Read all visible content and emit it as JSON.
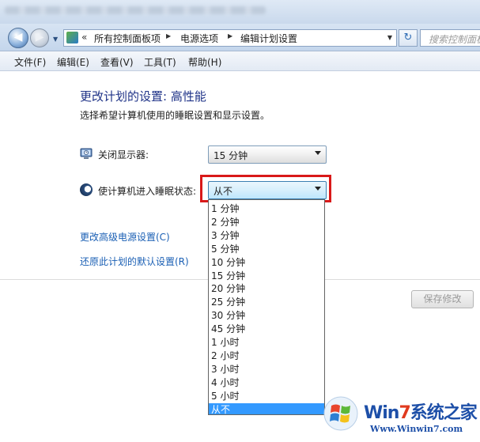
{
  "nav": {
    "back_glyph": "◀",
    "forward_glyph": "▶",
    "breadcrumb_prefix": "«",
    "breadcrumbs": [
      "所有控制面板项",
      "电源选项",
      "编辑计划设置"
    ],
    "refresh_glyph": "↻",
    "search_placeholder": "搜索控制面板"
  },
  "menu": [
    "文件(F)",
    "编辑(E)",
    "查看(V)",
    "工具(T)",
    "帮助(H)"
  ],
  "page": {
    "title": "更改计划的设置: 高性能",
    "subtitle": "选择希望计算机使用的睡眠设置和显示设置。"
  },
  "settings": {
    "display_label": "关闭显示器:",
    "display_value": "15 分钟",
    "sleep_label": "使计算机进入睡眠状态:",
    "sleep_value": "从不"
  },
  "dropdown_options": [
    "1 分钟",
    "2 分钟",
    "3 分钟",
    "5 分钟",
    "10 分钟",
    "15 分钟",
    "20 分钟",
    "25 分钟",
    "30 分钟",
    "45 分钟",
    "1 小时",
    "2 小时",
    "3 小时",
    "4 小时",
    "5 小时",
    "从不"
  ],
  "dropdown_selected": "从不",
  "links": {
    "advanced": "更改高级电源设置(C)",
    "restore": "还原此计划的默认设置(R)"
  },
  "buttons": {
    "save": "保存修改"
  },
  "watermark": {
    "brand_prefix": "Win",
    "brand_seven": "7",
    "brand_suffix": "系统之家",
    "url": "Www.Winwin7.com"
  },
  "colors": {
    "title": "#1e3287",
    "link": "#1a5fb4",
    "selection": "#3399ff",
    "highlight_box": "#d91919"
  }
}
